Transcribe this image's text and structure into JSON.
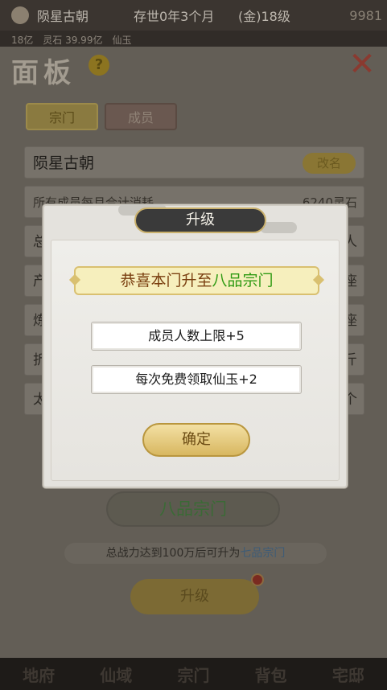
{
  "topbar": {
    "name": "陨星古朝",
    "time": "存世0年3个月",
    "level": "(金)18级",
    "money": "9981"
  },
  "resbar": [
    "18亿",
    "灵石 39.99亿",
    "仙玉"
  ],
  "panel": {
    "title": "面板",
    "tabs": [
      "宗门",
      "成员"
    ],
    "sect_name": "陨星古朝",
    "rename_label": "改名",
    "upkeep_label": "所有成员每月合计消耗",
    "upkeep_value": "6240灵石",
    "row_tails": [
      "人",
      "座",
      "座",
      "斤",
      "个"
    ],
    "row_heads": [
      "总",
      "产",
      "炼",
      "折",
      "太"
    ],
    "grade": "八品宗门",
    "requirement": "总战力达到100万后可升为",
    "requirement_highlight": "七品宗门",
    "upgrade_label": "升级"
  },
  "bottom_nav": [
    "地府",
    "仙域",
    "宗门",
    "背包",
    "宅邸"
  ],
  "modal": {
    "title": "升级",
    "congrats_prefix": "恭喜本门升至",
    "congrats_grade": "八品宗门",
    "benefits": [
      "成员人数上限+5",
      "每次免费领取仙玉+2"
    ],
    "confirm_label": "确定"
  },
  "colors": {
    "highlight_green": "#2e9a12",
    "button_gold": "#d8b760",
    "modal_title_bg": "#3a3a3a"
  }
}
